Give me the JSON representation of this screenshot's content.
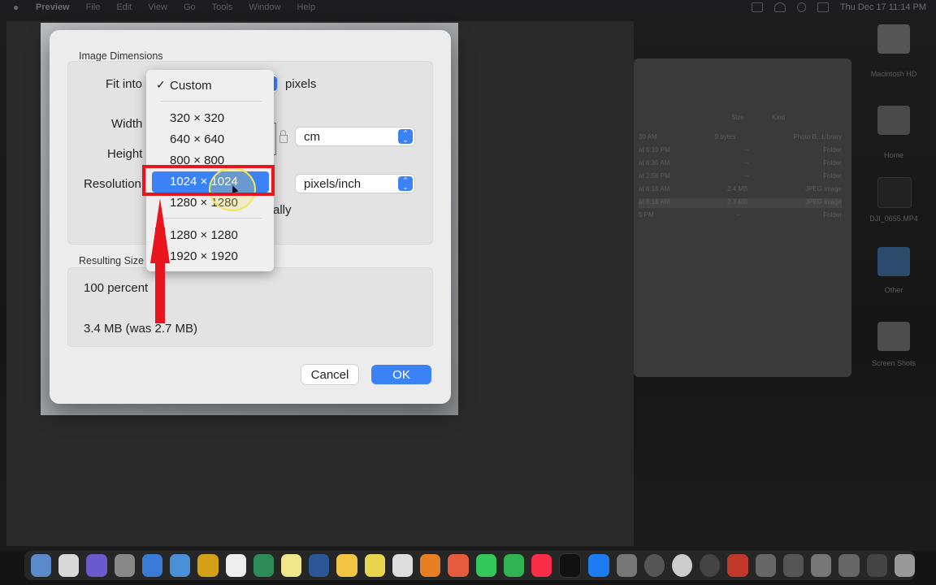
{
  "menubar": {
    "app_name": "Preview",
    "items": [
      "File",
      "Edit",
      "View",
      "Go",
      "Tools",
      "Window",
      "Help"
    ],
    "clock": "Thu Dec 17  11:14 PM"
  },
  "dialog": {
    "image_dimensions_label": "Image Dimensions",
    "fit_into_label": "Fit into",
    "fit_units": "pixels",
    "width_label": "Width",
    "height_label": "Height",
    "resolution_label": "Resolution",
    "size_units": "cm",
    "resolution_units": "pixels/inch",
    "scale_partial": "ally",
    "resulting_size_label": "Resulting Size",
    "percent": "100 percent",
    "file_size": "3.4 MB (was 2.7 MB)",
    "cancel_label": "Cancel",
    "ok_label": "OK"
  },
  "dropdown": {
    "selected": "Custom",
    "items": [
      "320 × 320",
      "640 × 640",
      "800 × 800",
      "1024 × 1024",
      "1280 × 1280",
      "1280 × 1280",
      "1920 × 1920"
    ],
    "highlighted": "1024 × 1024"
  },
  "finder": {
    "rows": [
      {
        "date": "30 AM",
        "size": "9 bytes",
        "kind": "Photo B...Library"
      },
      {
        "date": "at 5:10 PM",
        "size": "--",
        "kind": "Folder"
      },
      {
        "date": "at 8:35 AM",
        "size": "--",
        "kind": "Folder"
      },
      {
        "date": "at 2:58 PM",
        "size": "--",
        "kind": "Folder"
      },
      {
        "date": "at 8:18 AM",
        "size": "2.4 MB",
        "kind": "JPEG image"
      },
      {
        "date": "at 8:18 AM",
        "size": "2.3 MB",
        "kind": "JPEG image"
      },
      {
        "date": "5 PM",
        "size": "--",
        "kind": "Folder"
      }
    ],
    "header_size": "Size",
    "header_kind": "Kind"
  },
  "desktop": {
    "icons": [
      "Macintosh HD",
      "Home",
      "DJI_0655.MP4",
      "Other",
      "Screen Shots"
    ]
  },
  "colors": {
    "accent": "#3b82f6",
    "annotation": "#e8161c",
    "highlight_ring": "#f3e55a"
  }
}
